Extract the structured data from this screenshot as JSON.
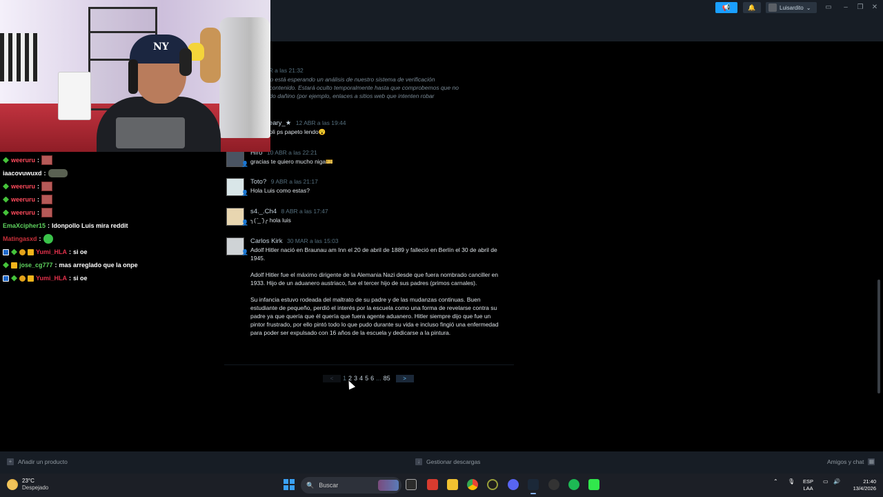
{
  "steam_header": {
    "username": "Luisardito"
  },
  "comments": [
    {
      "author": "",
      "date": "12 ABR a las 21:32",
      "text": "mentario está esperando un análisis de nuestro sistema de verificación\ntica de contenido. Estará oculto temporalmente hasta que comprobemos que no\ncontenido dañino (por ejemplo, enlaces a sitios web que intenten robar\nación)."
    },
    {
      "author": "ewerBeary_★",
      "date": "12 ABR a las 19:44",
      "text": "me la soli ps papeto lendo😮"
    },
    {
      "author": "Hiro",
      "date": "10 ABR a las 22:21",
      "text": "gracias te quiero mucho niga🎫"
    },
    {
      "author": "Toto?",
      "date": "9 ABR a las 21:17",
      "text": "Hola Luis como estas?"
    },
    {
      "author": "s4._.Ch4",
      "date": "8 ABR a las 17:47",
      "text": "╮( ̄_ ̄)╭ hola luis"
    },
    {
      "author": "Carlos Kirk",
      "date": "30 MAR a las 15:03",
      "paragraphs": [
        "Adolf Hitler nació en Braunau am Inn el 20 de abril de 1889 y falleció en Berlín el 30 de abril de 1945.",
        "Adolf Hitler fue el máximo dirigente de la Alemania Nazi desde que fuera nombrado canciller en 1933. Hijo de un aduanero austriaco, fue el tercer hijo de sus padres (primos carnales).",
        "Su infancia estuvo rodeada del maltrato de su padre y de las mudanzas continuas. Buen estudiante de pequeño, perdió el interés por la escuela como una forma de revelarse contra su padre ya que quería que él quería que fuera agente aduanero. Hitler siempre dijo que fue un pintor frustrado, por ello pintó todo lo que pudo durante su vida e incluso fingió una enfermedad para poder ser expulsado con 16 años de la escuela y dedicarse a la pintura."
      ]
    }
  ],
  "pagination": {
    "prev": "<",
    "pages": [
      "1",
      "2",
      "3",
      "4",
      "5",
      "6"
    ],
    "dots": "...",
    "last": "85",
    "next": ">",
    "current": "1"
  },
  "chat": [
    {
      "user": "weeruru",
      "msg": "",
      "emote": "red",
      "badges": [
        "green"
      ],
      "color": "#ff4b5c"
    },
    {
      "user": "iaacovuwuxd",
      "msg": "",
      "emote": "car",
      "badges": [],
      "color": "#ffffff"
    },
    {
      "user": "weeruru",
      "msg": "",
      "emote": "red",
      "badges": [
        "green"
      ],
      "color": "#ff4b5c"
    },
    {
      "user": "weeruru",
      "msg": "",
      "emote": "red",
      "badges": [
        "green"
      ],
      "color": "#ff4b5c"
    },
    {
      "user": "weeruru",
      "msg": "",
      "emote": "red",
      "badges": [
        "green"
      ],
      "color": "#ff4b5c"
    },
    {
      "user": "EmaXcipher15",
      "msg": "Idonpollo Luis mira reddit",
      "emote": "",
      "badges": [],
      "color": "#5fd35f"
    },
    {
      "user": "Matingasxd",
      "msg": "",
      "emote": "green",
      "badges": [],
      "color": "#c9303a"
    },
    {
      "user": "Yumi_HLA",
      "msg": "si oe",
      "emote": "",
      "badges": [
        "blue",
        "green",
        "gold",
        "crown"
      ],
      "color": "#e0304a"
    },
    {
      "user": "jose_cg777",
      "msg": "mas arreglado que la onpe",
      "emote": "",
      "badges": [
        "green",
        "crown"
      ],
      "color": "#5fd35f"
    },
    {
      "user": "Yumi_HLA",
      "msg": "si oe",
      "emote": "",
      "badges": [
        "blue",
        "green",
        "gold",
        "crown"
      ],
      "color": "#e0304a"
    }
  ],
  "bottombar": {
    "add_product": "Añadir un producto",
    "downloads": "Gestionar descargas",
    "friends": "Amigos y chat"
  },
  "taskbar": {
    "temperature": "23°C",
    "condition": "Despejado",
    "search_placeholder": "Buscar",
    "lang_top": "ESP",
    "lang_bottom": "LAA",
    "time": "21:40",
    "date": "13/4/2026"
  }
}
